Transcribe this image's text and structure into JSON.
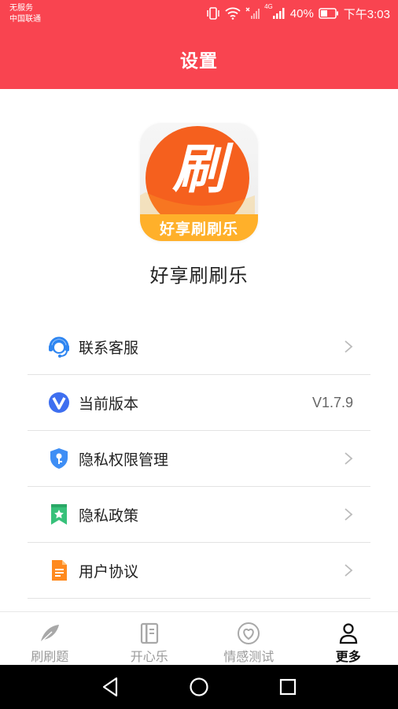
{
  "status_bar": {
    "line1": "无服务",
    "line2": "中国联通",
    "network": "4G",
    "battery": "40%",
    "time": "下午3:03"
  },
  "header": {
    "title": "设置"
  },
  "app": {
    "logo_char": "刷",
    "logo_banner": "好享刷刷乐",
    "name": "好享刷刷乐"
  },
  "menu": {
    "items": [
      {
        "label": "联系客服",
        "icon": "customer-service-icon"
      },
      {
        "label": "当前版本",
        "icon": "v-badge-icon",
        "value": "V1.7.9"
      },
      {
        "label": "隐私权限管理",
        "icon": "shield-key-icon"
      },
      {
        "label": "隐私政策",
        "icon": "bookmark-star-icon"
      },
      {
        "label": "用户协议",
        "icon": "document-icon"
      }
    ]
  },
  "tabbar": {
    "tabs": [
      {
        "label": "刷刷题",
        "icon": "feather-icon",
        "active": false
      },
      {
        "label": "开心乐",
        "icon": "notebook-icon",
        "active": false
      },
      {
        "label": "情感测试",
        "icon": "heart-icon",
        "active": false
      },
      {
        "label": "更多",
        "icon": "user-icon",
        "active": true
      }
    ]
  },
  "colors": {
    "header": "#f94450",
    "logo_orange": "#f5601e",
    "icon_blue": "#3e8ef5",
    "icon_green": "#37c17a",
    "icon_orange": "#ff8a1f"
  }
}
